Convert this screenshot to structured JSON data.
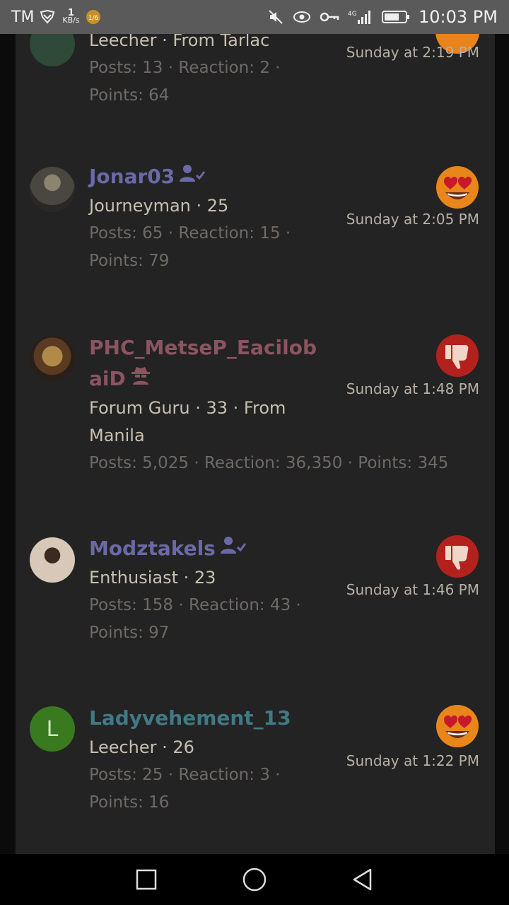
{
  "status_bar": {
    "carrier": "TM",
    "speed_value": "1",
    "speed_unit": "KB/s",
    "network_label": "4G",
    "time": "10:03 PM"
  },
  "reactions": [
    {
      "username": "",
      "title": "Leecher · From Tarlac",
      "stats_line1": "Posts: 13 · Reaction: 2 ·",
      "stats_line2": "Points: 64",
      "time": "Sunday at 2:19 PM",
      "reaction_icon": "heart-eyes-emoji-icon"
    },
    {
      "username": "Jonar03",
      "title": "Journeyman · 25",
      "stats_line1": "Posts: 65 · Reaction: 15 ·",
      "stats_line2": "Points: 79",
      "time": "Sunday at 2:05 PM",
      "reaction_icon": "heart-eyes-emoji-icon",
      "badge_icon": "verified-user-icon"
    },
    {
      "username_line1": "PHC_MetseP_Eacilob",
      "username_line2": "aiD",
      "title_line1": "Forum Guru · 33 · From",
      "title_line2": "Manila",
      "stats_line1": "Posts: 5,025 · Reaction: 36,350 · Points: 345",
      "time": "Sunday at 1:48 PM",
      "reaction_icon": "thumbs-down-icon",
      "badge_icon": "spy-icon"
    },
    {
      "username": "Modztakels",
      "title": "Enthusiast · 23",
      "stats_line1": "Posts: 158 · Reaction: 43 ·",
      "stats_line2": "Points: 97",
      "time": "Sunday at 1:46 PM",
      "reaction_icon": "thumbs-down-icon",
      "badge_icon": "verified-user-icon"
    },
    {
      "username": "Ladyvehement_13",
      "avatar_letter": "L",
      "title": "Leecher · 26",
      "stats_line1": "Posts: 25 · Reaction: 3 ·",
      "stats_line2": "Points: 16",
      "time": "Sunday at 1:22 PM",
      "reaction_icon": "heart-eyes-emoji-icon"
    }
  ],
  "colors": {
    "panel_bg": "#232323",
    "username_purple": "#6a6aa8",
    "username_maroon": "#8a5560",
    "username_teal": "#3f7a86",
    "avatar_green": "#3a7a1f",
    "thumbs_down_red": "#b3211d"
  }
}
